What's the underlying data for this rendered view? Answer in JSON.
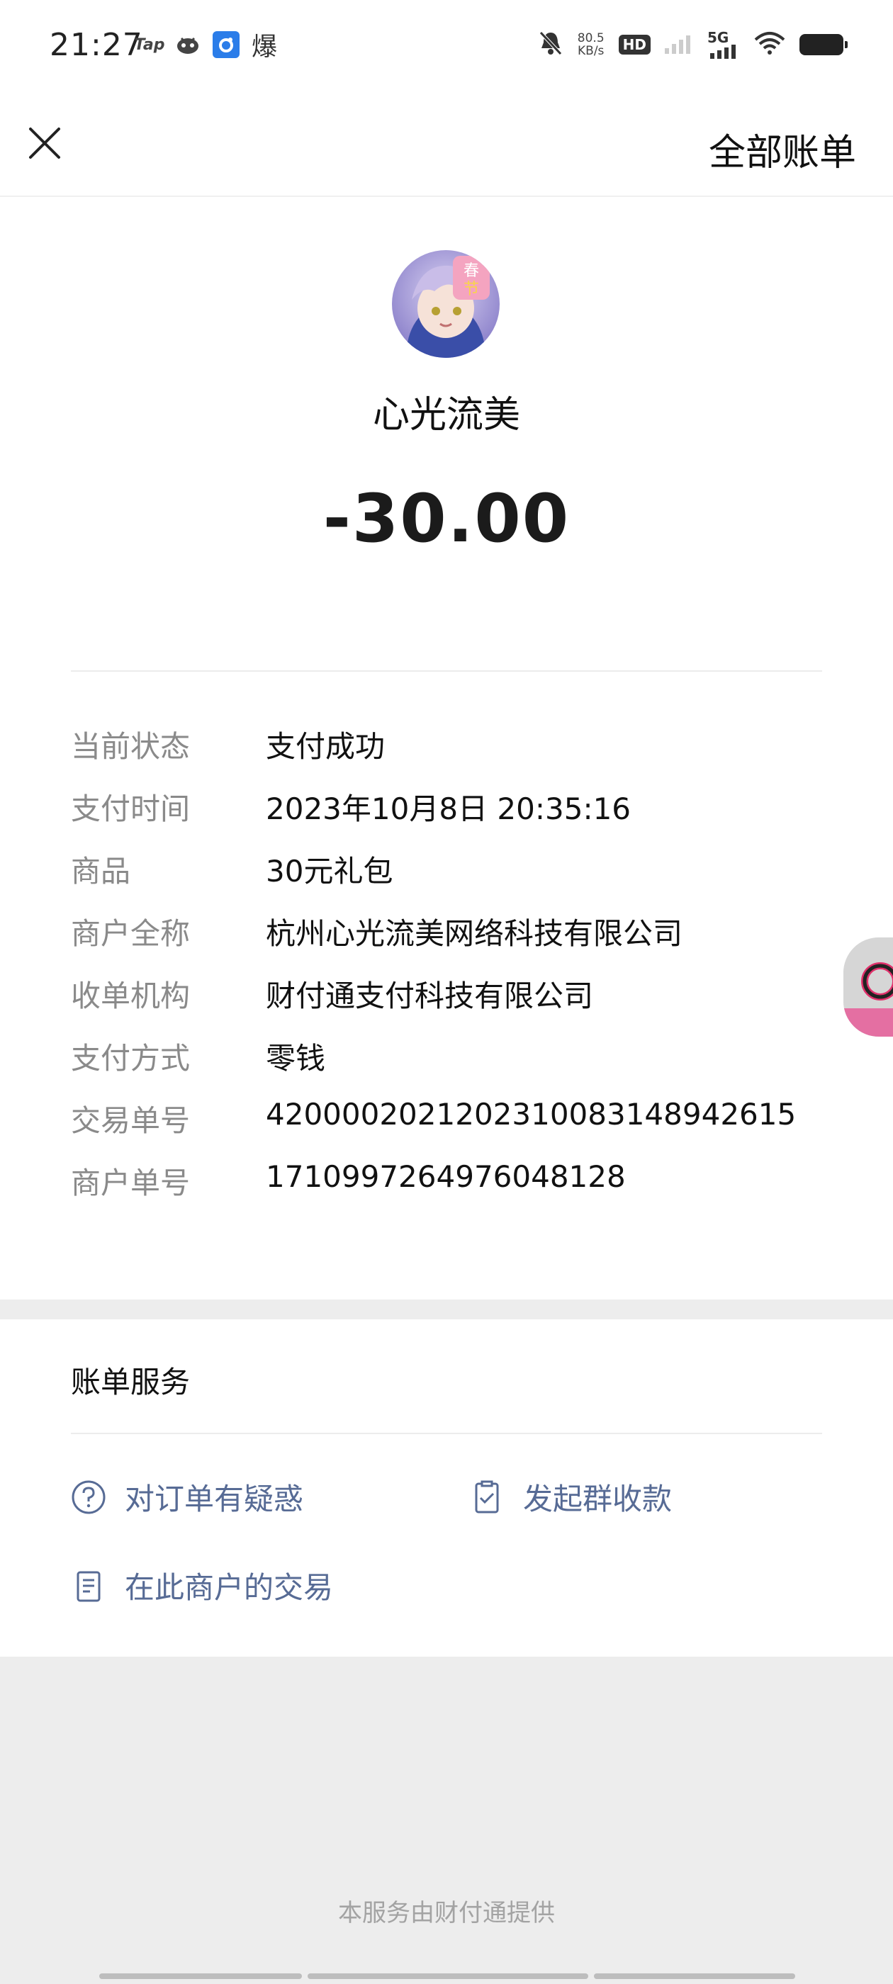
{
  "status_bar": {
    "time": "21:27",
    "apps": [
      "Tap",
      "bili-icon",
      "blue-app-icon",
      "爆"
    ],
    "speed_value": "80.5",
    "speed_unit": "KB/s",
    "hd_label": "HD",
    "network": "5G"
  },
  "header": {
    "close_icon": "close-icon",
    "all_bills_label": "全部账单"
  },
  "merchant": {
    "name": "心光流美",
    "amount": "-30.00"
  },
  "details": [
    {
      "label": "当前状态",
      "value": "支付成功"
    },
    {
      "label": "支付时间",
      "value": "2023年10月8日 20:35:16"
    },
    {
      "label": "商品",
      "value": "30元礼包"
    },
    {
      "label": "商户全称",
      "value": "杭州心光流美网络科技有限公司"
    },
    {
      "label": "收单机构",
      "value": "财付通支付科技有限公司"
    },
    {
      "label": "支付方式",
      "value": "零钱"
    },
    {
      "label": "交易单号",
      "value": "4200002021202310083148942615"
    },
    {
      "label": "商户单号",
      "value": "1710997264976048128"
    }
  ],
  "services": {
    "title": "账单服务",
    "items": [
      {
        "label": "对订单有疑惑",
        "icon": "question-circle-icon"
      },
      {
        "label": "发起群收款",
        "icon": "checklist-icon"
      },
      {
        "label": "在此商户的交易",
        "icon": "document-icon"
      }
    ]
  },
  "footer": {
    "provider_text": "本服务由财付通提供"
  },
  "colors": {
    "link": "#576b95",
    "label_gray": "#8a8a8a",
    "background": "#ededed"
  }
}
